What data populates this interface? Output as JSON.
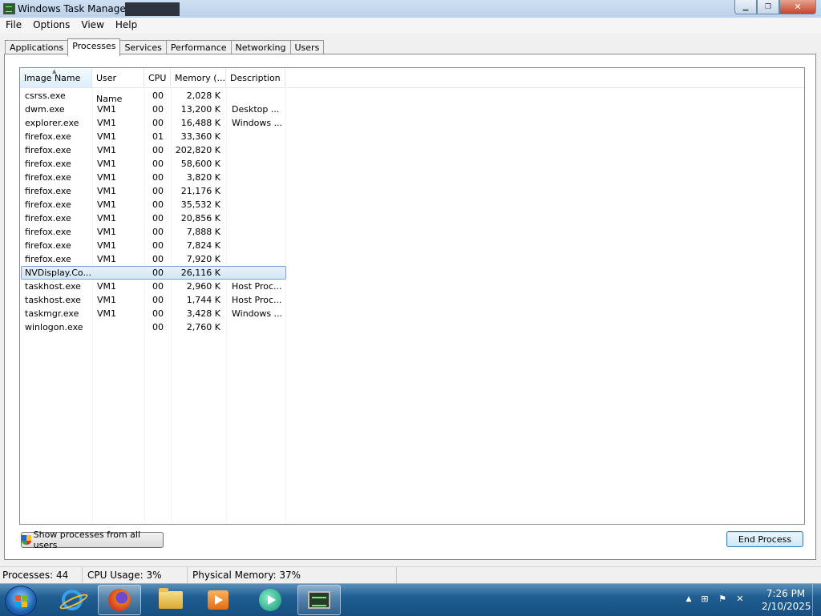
{
  "window": {
    "title": "Windows Task Manager",
    "controls": {
      "minimize": "▁",
      "maximize": "❐",
      "close": "✕"
    }
  },
  "menu": [
    "File",
    "Options",
    "View",
    "Help"
  ],
  "tabs": [
    {
      "label": "Applications",
      "active": false
    },
    {
      "label": "Processes",
      "active": true
    },
    {
      "label": "Services",
      "active": false
    },
    {
      "label": "Performance",
      "active": false
    },
    {
      "label": "Networking",
      "active": false
    },
    {
      "label": "Users",
      "active": false
    }
  ],
  "columns": {
    "name": "Image Name",
    "user": "User Name",
    "cpu": "CPU",
    "memory": "Memory (...",
    "description": "Description"
  },
  "processes": [
    {
      "name": "csrss.exe",
      "user": "",
      "cpu": "00",
      "memory": "2,028 K",
      "description": ""
    },
    {
      "name": "dwm.exe",
      "user": "VM1",
      "cpu": "00",
      "memory": "13,200 K",
      "description": "Desktop ..."
    },
    {
      "name": "explorer.exe",
      "user": "VM1",
      "cpu": "00",
      "memory": "16,488 K",
      "description": "Windows ..."
    },
    {
      "name": "firefox.exe",
      "user": "VM1",
      "cpu": "01",
      "memory": "33,360 K",
      "description": ""
    },
    {
      "name": "firefox.exe",
      "user": "VM1",
      "cpu": "00",
      "memory": "202,820 K",
      "description": ""
    },
    {
      "name": "firefox.exe",
      "user": "VM1",
      "cpu": "00",
      "memory": "58,600 K",
      "description": ""
    },
    {
      "name": "firefox.exe",
      "user": "VM1",
      "cpu": "00",
      "memory": "3,820 K",
      "description": ""
    },
    {
      "name": "firefox.exe",
      "user": "VM1",
      "cpu": "00",
      "memory": "21,176 K",
      "description": ""
    },
    {
      "name": "firefox.exe",
      "user": "VM1",
      "cpu": "00",
      "memory": "35,532 K",
      "description": ""
    },
    {
      "name": "firefox.exe",
      "user": "VM1",
      "cpu": "00",
      "memory": "20,856 K",
      "description": ""
    },
    {
      "name": "firefox.exe",
      "user": "VM1",
      "cpu": "00",
      "memory": "7,888 K",
      "description": ""
    },
    {
      "name": "firefox.exe",
      "user": "VM1",
      "cpu": "00",
      "memory": "7,824 K",
      "description": ""
    },
    {
      "name": "firefox.exe",
      "user": "VM1",
      "cpu": "00",
      "memory": "7,920 K",
      "description": ""
    },
    {
      "name": "NVDisplay.Co...",
      "user": "",
      "cpu": "00",
      "memory": "26,116 K",
      "description": "",
      "selected": true
    },
    {
      "name": "taskhost.exe",
      "user": "VM1",
      "cpu": "00",
      "memory": "2,960 K",
      "description": "Host Proc..."
    },
    {
      "name": "taskhost.exe",
      "user": "VM1",
      "cpu": "00",
      "memory": "1,744 K",
      "description": "Host Proc..."
    },
    {
      "name": "taskmgr.exe",
      "user": "VM1",
      "cpu": "00",
      "memory": "3,428 K",
      "description": "Windows ..."
    },
    {
      "name": "winlogon.exe",
      "user": "",
      "cpu": "00",
      "memory": "2,760 K",
      "description": ""
    }
  ],
  "buttons": {
    "show_all": "Show processes from all users",
    "end_process": "End Process"
  },
  "status": {
    "processes": "Processes: 44",
    "cpu": "CPU Usage: 3%",
    "memory": "Physical Memory: 37%"
  },
  "taskbar": {
    "pinned": [
      "start-orb",
      "internet-explorer-icon",
      "firefox-icon",
      "folder-icon",
      "media-center-icon",
      "media-player-icon",
      "task-manager-icon"
    ],
    "clock_time": "7:26 PM",
    "clock_date": "2/10/2025"
  }
}
